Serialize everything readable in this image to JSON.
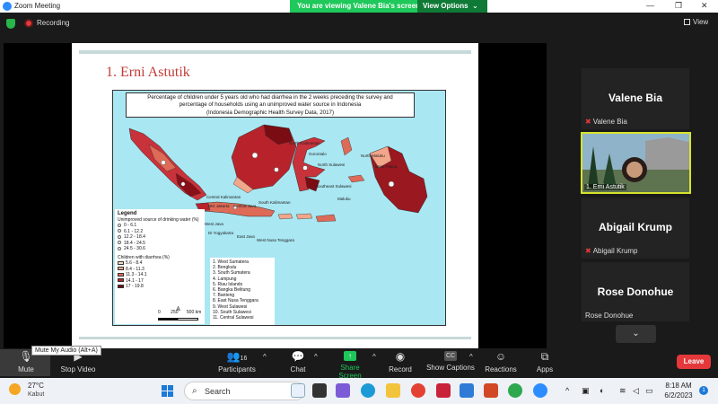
{
  "window": {
    "title": "Zoom Meeting"
  },
  "share_banner": {
    "text": "You are viewing Valene Bia's screen",
    "view_options": "View Options"
  },
  "top": {
    "recording": "Recording",
    "view": "View"
  },
  "slide": {
    "title": "1. Erni Astutik",
    "map_title_lines": [
      "Percentage of children under 5 years old who had diarrhea in the 2 weeks preceding the survey and",
      "percentage of households using an unimproved water source in Indonesia",
      "(Indonesia Demographic Health Survey Data, 2017)"
    ],
    "legend": {
      "title": "Legend",
      "water_heading": "Unimproved source of drinking water (%)",
      "water_items": [
        "0 - 6.1",
        "6.1 - 12.2",
        "12.2 - 18.4",
        "18.4 - 24.5",
        "24.5 - 30.6"
      ],
      "diarrhea_heading": "Children with diarrhea (%)",
      "diarrhea_items": [
        "5.6 - 8.4",
        "8.4 - 11.3",
        "11.3 - 14.1",
        "14.1 - 17",
        "17 - 19.8"
      ],
      "diarrhea_colors": [
        "#f7d9c4",
        "#f2a68a",
        "#de6b57",
        "#b8232b",
        "#7a0c14"
      ]
    },
    "scale": {
      "zero": "0",
      "mid": "250",
      "end": "500 km"
    },
    "numbered_list": [
      "1. West Sumatera",
      "2. Bengkulu",
      "3. South Sumatera",
      "4. Lampung",
      "5. Riau Islands",
      "6. Bangka Belitung",
      "7. Banteng",
      "8. East Nusa Tenggara",
      "9. West Sulawesi",
      "10. South Sulawesi",
      "11. Central Sulawesi"
    ],
    "map_labels": {
      "north_kalimantan": "North Kalimantan",
      "gorontalo": "Gorontalo",
      "north_maluku": "North Maluku",
      "north_sulawesi": "North Sulawesi",
      "west_papua": "West Papua",
      "central_kalimantan": "Central Kalimantan",
      "south_kalimantan": "South Kalimantan",
      "southeast_sulawesi": "Southeast Sulawesi",
      "maluku": "Maluku",
      "dki_jakarta": "DKI Jakarta",
      "central_java": "Central Java",
      "west_java": "West Java",
      "di_yogyakarta": "DI Yogyakarta",
      "east_java": "East Java",
      "west_nusa_tenggara": "West Nusa Tenggara"
    }
  },
  "participants": [
    {
      "big": "Valene Bia",
      "small": "Valene Bia"
    },
    {
      "small": "1. Erni Astutik"
    },
    {
      "big": "Abigail Krump",
      "small": "Abigail Krump"
    },
    {
      "big": "Rose Donohue",
      "small": "Rose Donohue"
    }
  ],
  "tooltip": "Mute My Audio (Alt+A)",
  "controls": {
    "mute": "Mute",
    "stop_video": "Stop Video",
    "participants": "Participants",
    "participant_count": "16",
    "chat": "Chat",
    "share_screen": "Share Screen",
    "record": "Record",
    "show_captions": "Show Captions",
    "cc": "CC",
    "reactions": "Reactions",
    "apps": "Apps",
    "leave": "Leave"
  },
  "taskbar": {
    "temperature": "27°C",
    "weather": "Kabut",
    "search_placeholder": "Search",
    "time": "8:18 AM",
    "date": "6/2/2023",
    "notifications": "1"
  }
}
